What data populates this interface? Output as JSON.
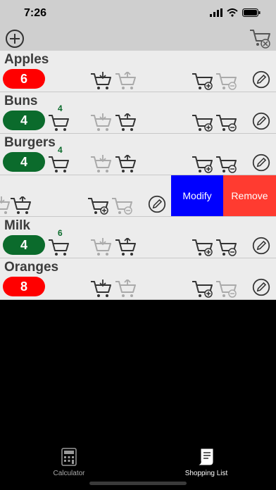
{
  "status": {
    "time": "7:26"
  },
  "items": [
    {
      "name": "Apples",
      "count": "6",
      "badge_color": "red",
      "cart_count": ""
    },
    {
      "name": "Buns",
      "count": "4",
      "badge_color": "green",
      "cart_count": "4"
    },
    {
      "name": "Burgers",
      "count": "4",
      "badge_color": "green",
      "cart_count": "4"
    },
    {
      "name": "",
      "count": "",
      "badge_color": "",
      "cart_count": ""
    },
    {
      "name": "Milk",
      "count": "4",
      "badge_color": "green",
      "cart_count": "6"
    },
    {
      "name": "Oranges",
      "count": "8",
      "badge_color": "red",
      "cart_count": ""
    }
  ],
  "swipe_actions": {
    "modify": "Modify",
    "remove": "Remove"
  },
  "tabs": [
    {
      "label": "Calculator",
      "icon": "calculator-icon"
    },
    {
      "label": "Shopping List",
      "icon": "receipt-icon"
    }
  ],
  "colors": {
    "red": "#ff0000",
    "green": "#0b6b2c",
    "modify": "#0000ff",
    "remove": "#ff3b30"
  }
}
